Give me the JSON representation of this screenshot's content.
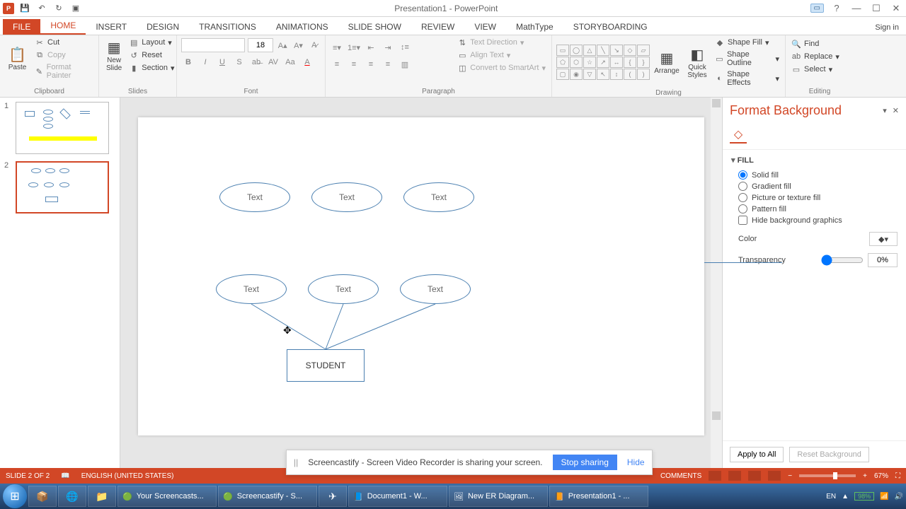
{
  "titlebar": {
    "title": "Presentation1 - PowerPoint",
    "signin": "Sign in"
  },
  "tabs": {
    "file": "FILE",
    "home": "HOME",
    "insert": "INSERT",
    "design": "DESIGN",
    "transitions": "TRANSITIONS",
    "animations": "ANIMATIONS",
    "slideshow": "SLIDE SHOW",
    "review": "REVIEW",
    "view": "VIEW",
    "mathtype": "MathType",
    "storyboarding": "STORYBOARDING"
  },
  "ribbon": {
    "clipboard": {
      "paste": "Paste",
      "cut": "Cut",
      "copy": "Copy",
      "fmtpainter": "Format Painter",
      "label": "Clipboard"
    },
    "slides": {
      "newslide": "New\nSlide",
      "layout": "Layout",
      "reset": "Reset",
      "section": "Section",
      "label": "Slides"
    },
    "font": {
      "size": "18",
      "label": "Font"
    },
    "paragraph": {
      "textdir": "Text Direction",
      "align": "Align Text",
      "smartart": "Convert to SmartArt",
      "label": "Paragraph"
    },
    "drawing": {
      "arrange": "Arrange",
      "quick": "Quick\nStyles",
      "fill": "Shape Fill",
      "outline": "Shape Outline",
      "effects": "Shape Effects",
      "label": "Drawing"
    },
    "editing": {
      "find": "Find",
      "replace": "Replace",
      "select": "Select",
      "label": "Editing"
    }
  },
  "thumbs": {
    "n1": "1",
    "n2": "2"
  },
  "canvas": {
    "oval1": "Text",
    "oval2": "Text",
    "oval3": "Text",
    "oval4": "Text",
    "oval5": "Text",
    "oval6": "Text",
    "rect": "STUDENT"
  },
  "pane": {
    "title": "Format Background",
    "fill": "FILL",
    "solid": "Solid fill",
    "gradient": "Gradient fill",
    "picture": "Picture or texture fill",
    "pattern": "Pattern fill",
    "hide": "Hide background graphics",
    "color": "Color",
    "transparency": "Transparency",
    "transp_val": "0%",
    "apply": "Apply to All",
    "reset": "Reset Background"
  },
  "notif": {
    "msg": "Screencastify - Screen Video Recorder is sharing your screen.",
    "stop": "Stop sharing",
    "hide": "Hide"
  },
  "status": {
    "slide": "SLIDE 2 OF 2",
    "lang": "ENGLISH (UNITED STATES)",
    "comments": "COMMENTS",
    "zoom": "67%"
  },
  "taskbar": {
    "t1": "Your Screencasts...",
    "t2": "Screencastify - S...",
    "t3": "Document1 - W...",
    "t4": "New ER Diagram...",
    "t5": "Presentation1 - ...",
    "tray_lang": "EN",
    "tray_batt": "98%"
  }
}
